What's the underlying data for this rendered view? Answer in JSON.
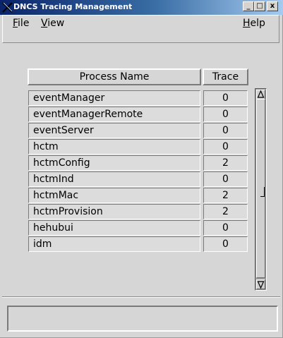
{
  "window": {
    "title": "DNCS Tracing Management",
    "controls": {
      "minimize": "_",
      "maximize": "□",
      "close": "x"
    }
  },
  "menu": {
    "file": {
      "mnemonic": "F",
      "rest": "ile"
    },
    "view": {
      "mnemonic": "V",
      "rest": "iew"
    },
    "help": {
      "mnemonic": "H",
      "rest": "elp"
    }
  },
  "table": {
    "columns": [
      "Process Name",
      "Trace"
    ],
    "rows": [
      {
        "name": "eventManager",
        "trace": "0"
      },
      {
        "name": "eventManagerRemote",
        "trace": "0"
      },
      {
        "name": "eventServer",
        "trace": "0"
      },
      {
        "name": "hctm",
        "trace": "0"
      },
      {
        "name": "hctmConfig",
        "trace": "2"
      },
      {
        "name": "hctmInd",
        "trace": "0"
      },
      {
        "name": "hctmMac",
        "trace": "2"
      },
      {
        "name": "hctmProvision",
        "trace": "2"
      },
      {
        "name": "hehubui",
        "trace": "0"
      },
      {
        "name": "idm",
        "trace": "0"
      }
    ]
  },
  "status": {
    "text": ""
  },
  "icons": {
    "app": "x-logo-icon",
    "scroll_up": "arrow-up-icon",
    "scroll_down": "arrow-down-icon"
  }
}
